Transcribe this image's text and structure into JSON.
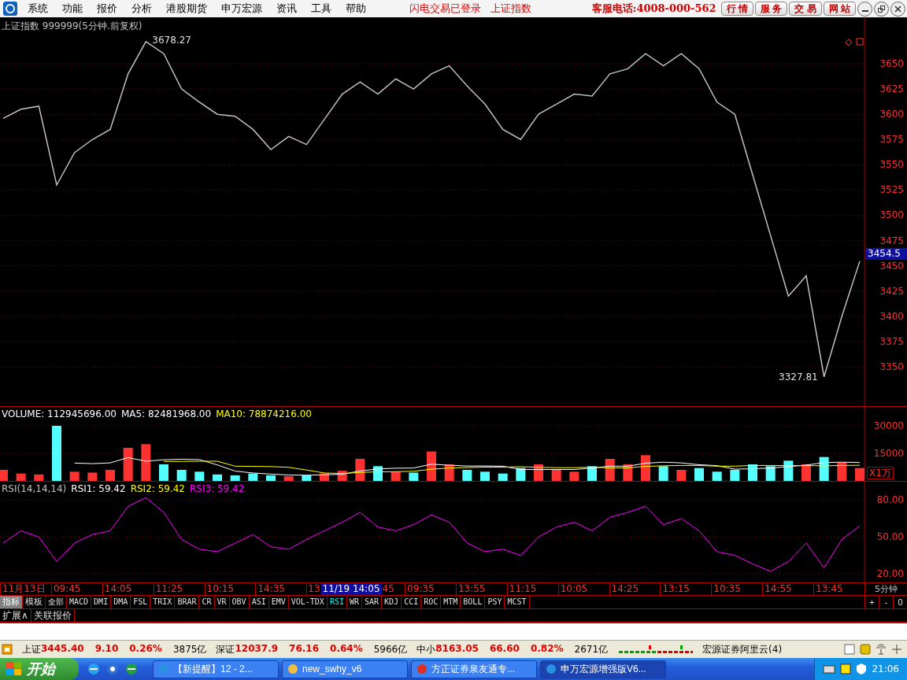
{
  "menu": {
    "items": [
      "系统",
      "功能",
      "报价",
      "分析",
      "港股期货",
      "申万宏源",
      "资讯",
      "工具",
      "帮助"
    ],
    "notices": [
      "闪电交易已登录",
      "上证指数"
    ],
    "hotline": "客服电话:4008-000-562",
    "buttons": [
      "行 情",
      "服 务",
      "交 易",
      "网 站"
    ]
  },
  "price_panel": {
    "title": "上证指数 999999(5分钟.前复权)",
    "current": "3454.5",
    "chart_data": {
      "type": "line",
      "ylim": [
        3311,
        3696
      ],
      "grid": true,
      "yticks": [
        3350,
        3375,
        3400,
        3425,
        3450,
        3475,
        3500,
        3525,
        3550,
        3575,
        3600,
        3625,
        3650
      ],
      "series": [
        {
          "color": "#c0c0c0",
          "values": [
            3596,
            3605,
            3608,
            3530,
            3562,
            3575,
            3585,
            3640,
            3672,
            3660,
            3625,
            3612,
            3600,
            3598,
            3585,
            3565,
            3578,
            3570,
            3595,
            3620,
            3632,
            3620,
            3635,
            3625,
            3640,
            3648,
            3628,
            3610,
            3585,
            3575,
            3600,
            3610,
            3620,
            3618,
            3640,
            3645,
            3660,
            3648,
            3660,
            3645,
            3612,
            3600,
            3540,
            3480,
            3420,
            3440,
            3340,
            3400,
            3454.5
          ]
        }
      ],
      "annotations": [
        "3678.27",
        "3327.81"
      ]
    }
  },
  "volume_panel": {
    "legend": [
      {
        "label": "VOLUME: 112945696.00",
        "color": "#ffffff"
      },
      {
        "label": "MA5: 82481968.00",
        "color": "#ffffff"
      },
      {
        "label": "MA10: 78874216.00",
        "color": "#ffff00"
      }
    ],
    "unit": "X1万",
    "chart_data": {
      "type": "bar",
      "ylim": [
        0,
        40300
      ],
      "grid": true,
      "yticks": [
        15000,
        30000
      ],
      "series": [
        {
          "colors": [
            "#ff3232",
            "#ff3232",
            "#ff3232",
            "#54ffff",
            "#ff3232",
            "#ff3232",
            "#ff3232",
            "#ff3232",
            "#ff3232",
            "#54ffff",
            "#54ffff",
            "#54ffff",
            "#54ffff",
            "#54ffff",
            "#54ffff",
            "#54ffff",
            "#ff3232",
            "#54ffff",
            "#ff3232",
            "#ff3232",
            "#ff3232",
            "#54ffff",
            "#ff3232",
            "#54ffff",
            "#ff3232",
            "#ff3232",
            "#54ffff",
            "#54ffff",
            "#54ffff",
            "#54ffff",
            "#ff3232",
            "#ff3232",
            "#ff3232",
            "#54ffff",
            "#ff3232",
            "#ff3232",
            "#ff3232",
            "#54ffff",
            "#ff3232",
            "#54ffff",
            "#54ffff",
            "#54ffff",
            "#54ffff",
            "#54ffff",
            "#54ffff",
            "#ff3232",
            "#54ffff",
            "#ff3232",
            "#ff3232"
          ],
          "values": [
            6000,
            4000,
            3500,
            30000,
            5000,
            4500,
            6000,
            18000,
            20000,
            9000,
            6000,
            5000,
            3500,
            3000,
            4000,
            3000,
            2500,
            3000,
            4000,
            5500,
            12000,
            8000,
            5000,
            4500,
            16000,
            9000,
            6000,
            5000,
            4000,
            7000,
            9000,
            6000,
            5000,
            8000,
            12000,
            9000,
            14000,
            8000,
            6000,
            7000,
            5000,
            6000,
            9000,
            8000,
            11000,
            9000,
            13000,
            10000,
            7000
          ]
        },
        {
          "type": "line",
          "color": "#ffffff",
          "values": [
            null,
            null,
            null,
            null,
            9700,
            9400,
            9800,
            12700,
            10700,
            11500,
            11800,
            11600,
            8700,
            5300,
            4300,
            3700,
            3200,
            3100,
            3300,
            3600,
            5400,
            6500,
            6900,
            7000,
            9100,
            8500,
            8100,
            8100,
            8000,
            6200,
            6200,
            6200,
            6200,
            7000,
            8000,
            8000,
            9600,
            10200,
            9800,
            8800,
            8300,
            6400,
            6600,
            7000,
            7800,
            8600,
            10000,
            10200,
            10000
          ]
        },
        {
          "type": "line",
          "color": "#ffff00",
          "values": [
            null,
            null,
            null,
            null,
            null,
            null,
            null,
            null,
            null,
            10600,
            10600,
            10700,
            10700,
            8000,
            7900,
            7800,
            7400,
            5900,
            4300,
            4000,
            4600,
            4900,
            5000,
            5200,
            6400,
            7000,
            7300,
            7500,
            7500,
            7700,
            7400,
            7200,
            7200,
            7500,
            7100,
            7100,
            7900,
            8200,
            8400,
            8400,
            8000,
            8000,
            8400,
            8400,
            8300,
            8300,
            8200,
            8400,
            8500
          ]
        }
      ]
    }
  },
  "rsi_panel": {
    "legend": [
      {
        "label": "RSI(14,14,14)",
        "color": "#c0c0c0"
      },
      {
        "label": "RSI1: 59.42",
        "color": "#ffffff"
      },
      {
        "label": "RSI2: 59.42",
        "color": "#ffff00"
      },
      {
        "label": "RSI3: 59.42",
        "color": "#ff00ff"
      }
    ],
    "chart_data": {
      "type": "line",
      "ylim": [
        13,
        95
      ],
      "grid": true,
      "yticks": [
        {
          "value": 20,
          "label": "20.00"
        },
        {
          "value": 50,
          "label": "50.00"
        },
        {
          "value": 80,
          "label": "80.00"
        }
      ],
      "series": [
        {
          "color": "#ff00ff",
          "values": [
            45,
            55,
            50,
            30,
            45,
            52,
            55,
            75,
            82,
            70,
            48,
            40,
            38,
            45,
            52,
            42,
            40,
            48,
            55,
            62,
            70,
            58,
            55,
            60,
            68,
            62,
            45,
            38,
            40,
            35,
            50,
            58,
            62,
            55,
            66,
            70,
            75,
            60,
            65,
            55,
            38,
            35,
            28,
            22,
            30,
            45,
            25,
            48,
            59
          ]
        }
      ]
    }
  },
  "time_axis": {
    "labels": [
      "11月13日",
      "09:45",
      "14:05",
      "11:25",
      "10:15",
      "14:35",
      "13",
      "45",
      "09:35",
      "13:55",
      "11:15",
      "10:05",
      "14:25",
      "13:15",
      "10:35",
      "14:55",
      "13:45"
    ],
    "cursor": "11/19 14:05",
    "period": "5分钟"
  },
  "tabs": [
    {
      "label": "指标",
      "selected": true
    },
    {
      "label": "模板",
      "selected": false
    }
  ],
  "indicator_tabs": [
    {
      "label": "全部",
      "selected": false
    },
    {
      "label": "MACD",
      "selected": false
    },
    {
      "label": "DMI",
      "selected": false
    },
    {
      "label": "DMA",
      "selected": false
    },
    {
      "label": "FSL",
      "selected": false
    },
    {
      "label": "TRIX",
      "selected": false
    },
    {
      "label": "BRAR",
      "selected": false
    },
    {
      "label": "CR",
      "selected": false
    },
    {
      "label": "VR",
      "selected": false
    },
    {
      "label": "OBV",
      "selected": false
    },
    {
      "label": "ASI",
      "selected": false
    },
    {
      "label": "EMV",
      "selected": false
    },
    {
      "label": "VOL-TDX",
      "selected": false
    },
    {
      "label": "RSI",
      "selected": true
    },
    {
      "label": "WR",
      "selected": false
    },
    {
      "label": "SAR",
      "selected": false
    },
    {
      "label": "KDJ",
      "selected": false
    },
    {
      "label": "CCI",
      "selected": false
    },
    {
      "label": "ROC",
      "selected": false
    },
    {
      "label": "MTM",
      "selected": false
    },
    {
      "label": "BOLL",
      "selected": false
    },
    {
      "label": "PSY",
      "selected": false
    },
    {
      "label": "MCST",
      "selected": false
    }
  ],
  "zoom_buttons": [
    "+",
    "-",
    "0"
  ],
  "sub_tabs": [
    "扩展∧",
    "关联报价"
  ],
  "status_bar": {
    "indices": [
      {
        "name": "上证",
        "price": "3445.40",
        "change": "9.10",
        "percent": "0.26%",
        "turnover": "3875亿"
      },
      {
        "name": "深证",
        "price": "12037.9",
        "change": "76.16",
        "percent": "0.64%",
        "turnover": "5966亿"
      },
      {
        "name": "中小",
        "price": "8163.05",
        "change": "66.60",
        "percent": "0.82%",
        "turnover": "2671亿"
      }
    ],
    "server": "宏源证券阿里云(4)"
  },
  "taskbar": {
    "start": "开始",
    "tasks": [
      {
        "label": "【新提醒】12 - 2...",
        "selected": false
      },
      {
        "label": "new_swhy_v6",
        "selected": false
      },
      {
        "label": "方正证券泉友通专...",
        "selected": false
      },
      {
        "label": "申万宏源增强版V6...",
        "selected": true
      }
    ],
    "clock": "21:06"
  }
}
